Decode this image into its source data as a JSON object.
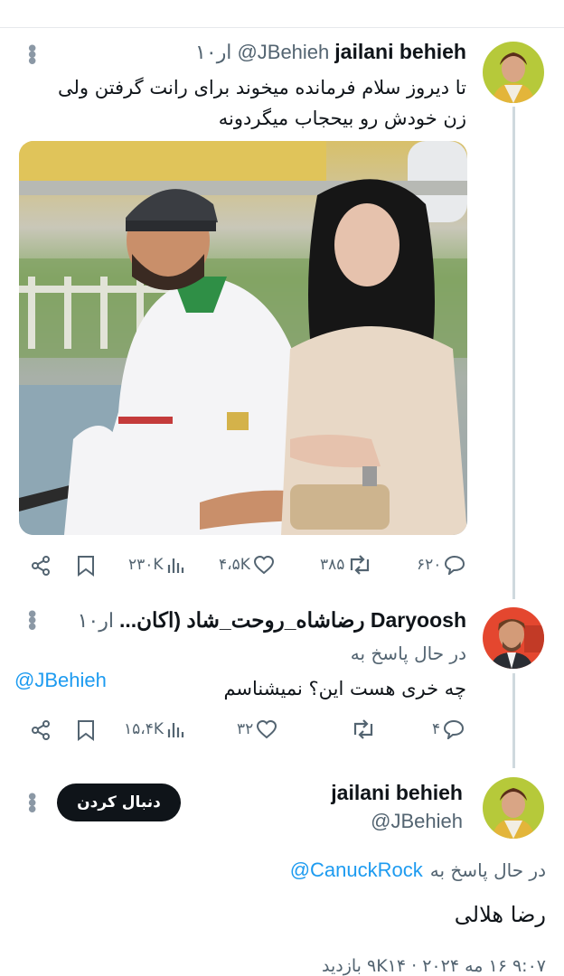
{
  "tweet1": {
    "name": "jailani behieh",
    "handle": "@JBehieh",
    "time": "۱۰ار",
    "text_line1": "تا دیروز سلام فرمانده میخوند برای رانت گرفتن ولی",
    "text_line2": "زن خودش رو بیحجاب میگردونه",
    "stats": {
      "replies": "۶۲۰",
      "retweets": "۳۸۵",
      "likes": "۴،۵K",
      "views": "۲۳۰K"
    }
  },
  "tweet2": {
    "name": "...رضاشاه_روحت_شاد (اکان Daryoosh",
    "time": "۱۰ار",
    "replying_prefix": "در حال پاسخ به",
    "replying_to": "@JBehieh",
    "text": "چه خری هست این؟ نمیشناسم",
    "stats": {
      "replies": "۴",
      "retweets": "",
      "likes": "۳۲",
      "views": "۱۵،۴K"
    }
  },
  "tweet3": {
    "name": "jailani behieh",
    "handle": "@JBehieh",
    "follow_label": "دنبال کردن",
    "replying_prefix": "در حال پاسخ به",
    "replying_to": "@CanuckRock",
    "text": "رضا هلالی",
    "meta_line": "۹:۰۷ ۱۶ مه ۲۰۲۴ · ۹K۱۴ بازدید"
  },
  "colors": {
    "accent": "#1d9bf0",
    "text": "#0f1419",
    "secondary": "#536471",
    "button_bg": "#0f1419"
  },
  "icons": [
    "share-icon",
    "bookmark-icon",
    "views-icon",
    "like-icon",
    "retweet-icon",
    "reply-icon",
    "more-icon"
  ]
}
